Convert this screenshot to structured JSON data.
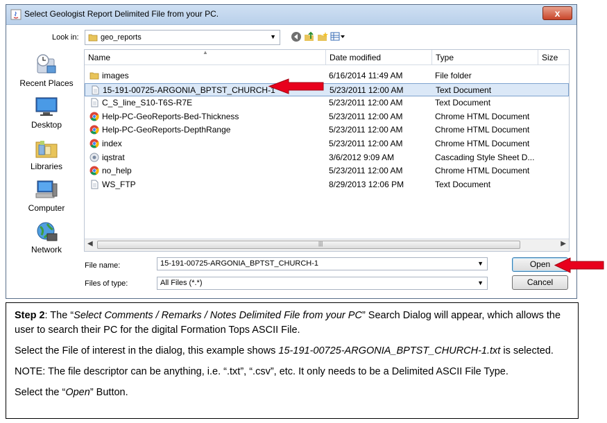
{
  "dialog": {
    "title": "Select Geologist Report Delimited File from your PC.",
    "close_label": "x",
    "look_in_label": "Look in:",
    "look_in_value": "geo_reports"
  },
  "places": [
    {
      "label": "Recent Places",
      "icon": "recent-places-icon"
    },
    {
      "label": "Desktop",
      "icon": "desktop-icon"
    },
    {
      "label": "Libraries",
      "icon": "libraries-icon"
    },
    {
      "label": "Computer",
      "icon": "computer-icon"
    },
    {
      "label": "Network",
      "icon": "network-icon"
    }
  ],
  "columns": [
    "Name",
    "Date modified",
    "Type",
    "Size"
  ],
  "files": [
    {
      "name": "images",
      "date": "6/16/2014 11:49 AM",
      "type": "File folder",
      "icon": "folder-icon"
    },
    {
      "name": "15-191-00725-ARGONIA_BPTST_CHURCH-1",
      "date": "5/23/2011 12:00 AM",
      "type": "Text Document",
      "icon": "text-file-icon",
      "selected": true
    },
    {
      "name": "C_S_line_S10-T6S-R7E",
      "date": "5/23/2011 12:00 AM",
      "type": "Text Document",
      "icon": "text-file-icon"
    },
    {
      "name": "Help-PC-GeoReports-Bed-Thickness",
      "date": "5/23/2011 12:00 AM",
      "type": "Chrome HTML Document",
      "icon": "chrome-icon"
    },
    {
      "name": "Help-PC-GeoReports-DepthRange",
      "date": "5/23/2011 12:00 AM",
      "type": "Chrome HTML Document",
      "icon": "chrome-icon"
    },
    {
      "name": "index",
      "date": "5/23/2011 12:00 AM",
      "type": "Chrome HTML Document",
      "icon": "chrome-icon"
    },
    {
      "name": "iqstrat",
      "date": "3/6/2012 9:09 AM",
      "type": "Cascading Style Sheet D...",
      "icon": "css-file-icon"
    },
    {
      "name": "no_help",
      "date": "5/23/2011 12:00 AM",
      "type": "Chrome HTML Document",
      "icon": "chrome-icon"
    },
    {
      "name": "WS_FTP",
      "date": "8/29/2013 12:06 PM",
      "type": "Text Document",
      "icon": "text-file-icon"
    }
  ],
  "filename_label": "File name:",
  "filename_value": "15-191-00725-ARGONIA_BPTST_CHURCH-1",
  "filetype_label": "Files of type:",
  "filetype_value": "All Files (*.*)",
  "open_label": "Open",
  "cancel_label": "Cancel",
  "note": {
    "p1_step": "Step 2",
    "p1_a": ": The “",
    "p1_em": "Select Comments / Remarks / Notes  Delimited File from your PC",
    "p1_b": "” Search Dialog will appear, which allows the user to search their PC for the digital Formation Tops ASCII File.",
    "p2_a": "Select the File of interest in the dialog, this example shows ",
    "p2_em": "15-191-00725-ARGONIA_BPTST_CHURCH-1.txt",
    "p2_b": " is selected.",
    "p3": "NOTE: The file descriptor can be anything, i.e. “.txt”, “.csv”, etc.  It only needs to be a Delimited ASCII File Type.",
    "p4_a": "Select the “",
    "p4_em": "Open",
    "p4_b": "” Button."
  },
  "colors": {
    "arrow": "#e8001c",
    "selection": "#dbe8f7"
  }
}
